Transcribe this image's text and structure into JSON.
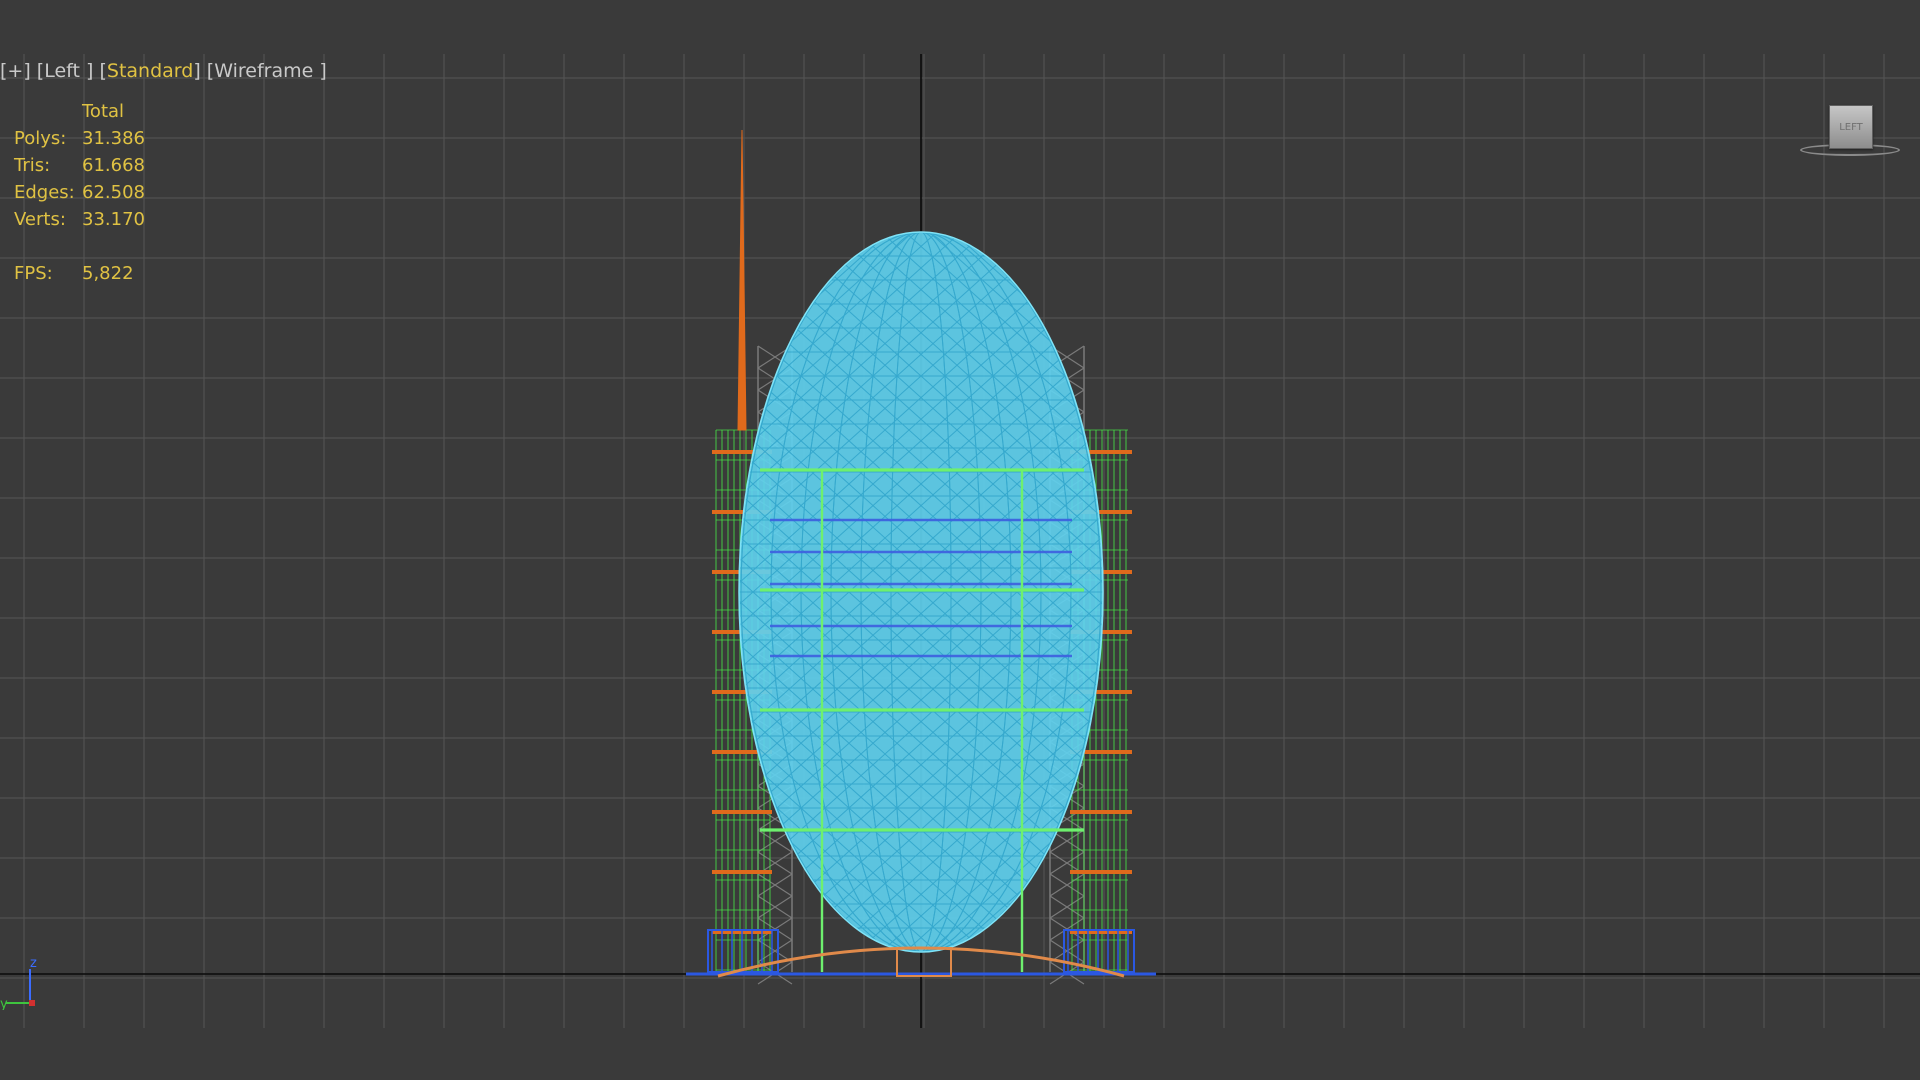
{
  "viewport": {
    "label": {
      "plus": "[+]",
      "view": "[Left ]",
      "shading_open": "[",
      "shading": "Standard",
      "shading_close": "]",
      "mode": "[Wireframe ]"
    },
    "stats": {
      "header": "Total",
      "rows": [
        {
          "label": "Polys:",
          "value": "31.386"
        },
        {
          "label": "Tris:",
          "value": "61.668"
        },
        {
          "label": "Edges:",
          "value": "62.508"
        },
        {
          "label": "Verts:",
          "value": "33.170"
        }
      ],
      "fps_label": "FPS:",
      "fps_value": "5,822"
    },
    "viewcube_label": "LEFT",
    "axis_labels": {
      "z": "z",
      "y": "y"
    }
  },
  "colors": {
    "background": "#3a3a3a",
    "grid": "#555555",
    "axis": "#0a0a0a",
    "stats_text": "#e0c243",
    "label_text": "#c9c9c9",
    "shell": "#5fd0ee",
    "frame": "#46e046",
    "tower": "#7a7a7a",
    "orange": "#e06a1c",
    "base": "#2b58e2"
  }
}
